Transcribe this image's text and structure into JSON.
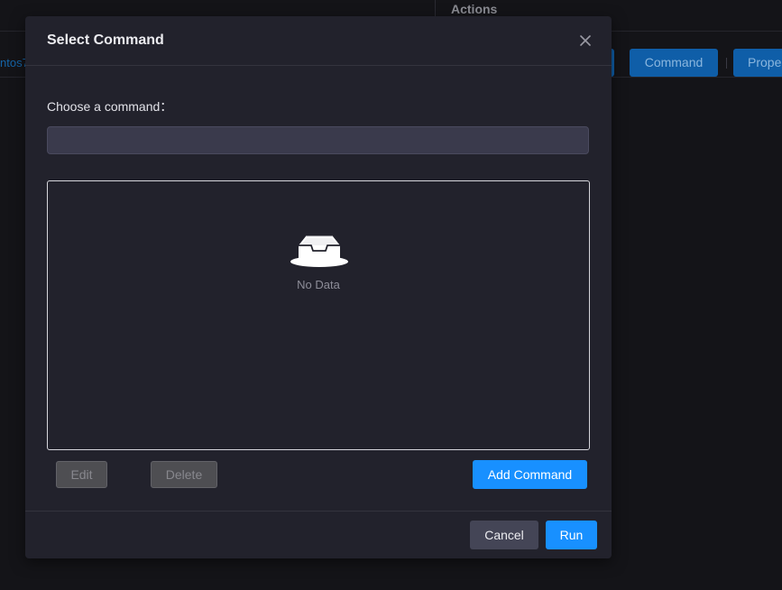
{
  "background": {
    "actions_title": "Actions",
    "left_link": "ntos7",
    "command_button": "Command",
    "properties_button": "Prope"
  },
  "modal": {
    "title": "Select Command",
    "close_icon": "close-icon",
    "field_label": "Choose a command：",
    "input_value": "",
    "input_placeholder": "",
    "empty_icon": "empty-inbox-icon",
    "empty_text": "No Data",
    "edit_button": "Edit",
    "delete_button": "Delete",
    "add_button": "Add Command",
    "cancel_button": "Cancel",
    "run_button": "Run"
  },
  "colors": {
    "primary": "#1890ff",
    "modal_bg": "#22222c",
    "page_bg": "#141418",
    "disabled_bg": "#4e4e52"
  }
}
